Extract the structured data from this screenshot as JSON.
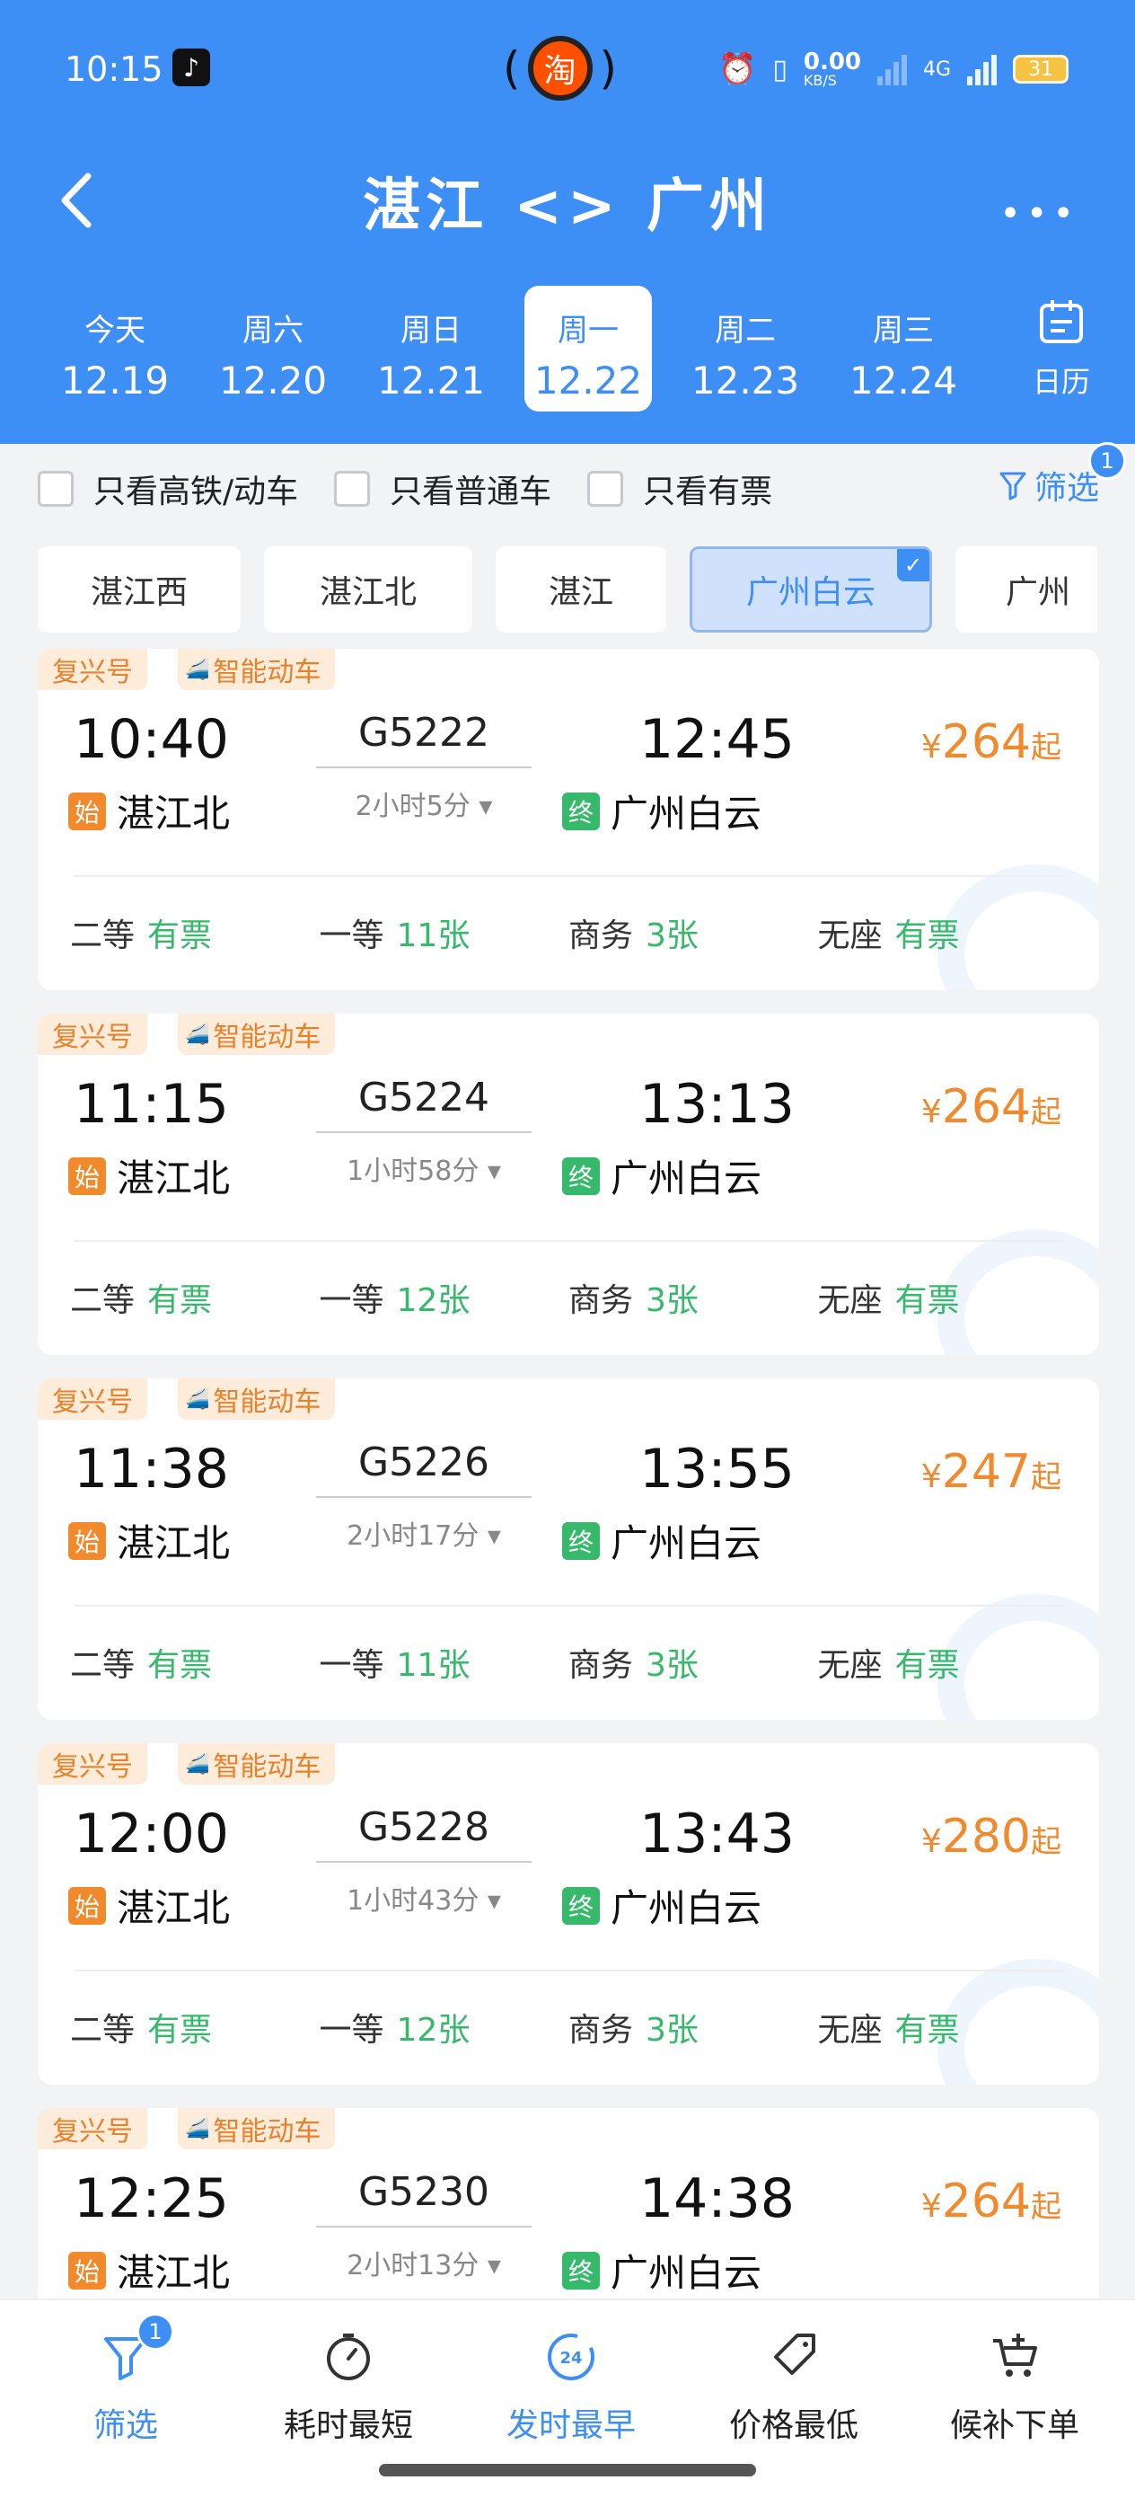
{
  "status": {
    "time": "10:15",
    "speed": "0.00",
    "speed_unit": "KB/S",
    "network": "4G",
    "battery": "31",
    "taobao": "淘"
  },
  "header": {
    "title": "湛江 <> 广州",
    "more": "•••"
  },
  "dates": [
    {
      "weekday": "今天",
      "date": "12.19"
    },
    {
      "weekday": "周六",
      "date": "12.20"
    },
    {
      "weekday": "周日",
      "date": "12.21"
    },
    {
      "weekday": "周一",
      "date": "12.22",
      "selected": true
    },
    {
      "weekday": "周二",
      "date": "12.23"
    },
    {
      "weekday": "周三",
      "date": "12.24"
    }
  ],
  "calendar_label": "日历",
  "filters": {
    "gaotie": "只看高铁/动车",
    "putong": "只看普通车",
    "youpiao": "只看有票",
    "filter_btn": "筛选",
    "filter_count": "1"
  },
  "stations": [
    "湛江西",
    "湛江北",
    "湛江",
    "广州白云",
    "广州"
  ],
  "tag_labels": {
    "type": "复兴号",
    "smart": "智能动车",
    "start": "始",
    "end": "终",
    "yen": "¥",
    "qi": "起"
  },
  "trains": [
    {
      "dep": "10:40",
      "arr": "12:45",
      "no": "G5222",
      "dur": "2小时5分",
      "from": "湛江北",
      "to": "广州白云",
      "price": "264",
      "seats": [
        {
          "k": "二等",
          "v": "有票"
        },
        {
          "k": "一等",
          "v": "11张"
        },
        {
          "k": "商务",
          "v": "3张"
        },
        {
          "k": "无座",
          "v": "有票"
        }
      ]
    },
    {
      "dep": "11:15",
      "arr": "13:13",
      "no": "G5224",
      "dur": "1小时58分",
      "from": "湛江北",
      "to": "广州白云",
      "price": "264",
      "seats": [
        {
          "k": "二等",
          "v": "有票"
        },
        {
          "k": "一等",
          "v": "12张"
        },
        {
          "k": "商务",
          "v": "3张"
        },
        {
          "k": "无座",
          "v": "有票"
        }
      ]
    },
    {
      "dep": "11:38",
      "arr": "13:55",
      "no": "G5226",
      "dur": "2小时17分",
      "from": "湛江北",
      "to": "广州白云",
      "price": "247",
      "seats": [
        {
          "k": "二等",
          "v": "有票"
        },
        {
          "k": "一等",
          "v": "11张"
        },
        {
          "k": "商务",
          "v": "3张"
        },
        {
          "k": "无座",
          "v": "有票"
        }
      ]
    },
    {
      "dep": "12:00",
      "arr": "13:43",
      "no": "G5228",
      "dur": "1小时43分",
      "from": "湛江北",
      "to": "广州白云",
      "price": "280",
      "seats": [
        {
          "k": "二等",
          "v": "有票"
        },
        {
          "k": "一等",
          "v": "12张"
        },
        {
          "k": "商务",
          "v": "3张"
        },
        {
          "k": "无座",
          "v": "有票"
        }
      ]
    },
    {
      "dep": "12:25",
      "arr": "14:38",
      "no": "G5230",
      "dur": "2小时13分",
      "from": "湛江北",
      "to": "广州白云",
      "price": "264",
      "seats": []
    }
  ],
  "bottom_nav": [
    {
      "label": "筛选",
      "badge": "1",
      "icon": "filter-icon",
      "active": true
    },
    {
      "label": "耗时最短",
      "icon": "timer-icon"
    },
    {
      "label": "发时最早",
      "icon": "clock-24-icon",
      "icon_text": "24",
      "active": true
    },
    {
      "label": "价格最低",
      "icon": "price-tag-icon"
    },
    {
      "label": "候补下单",
      "icon": "cart-add-icon"
    }
  ],
  "colors": {
    "primary": "#3d8ef5",
    "price": "#f08a2c",
    "available": "#36b96a"
  }
}
